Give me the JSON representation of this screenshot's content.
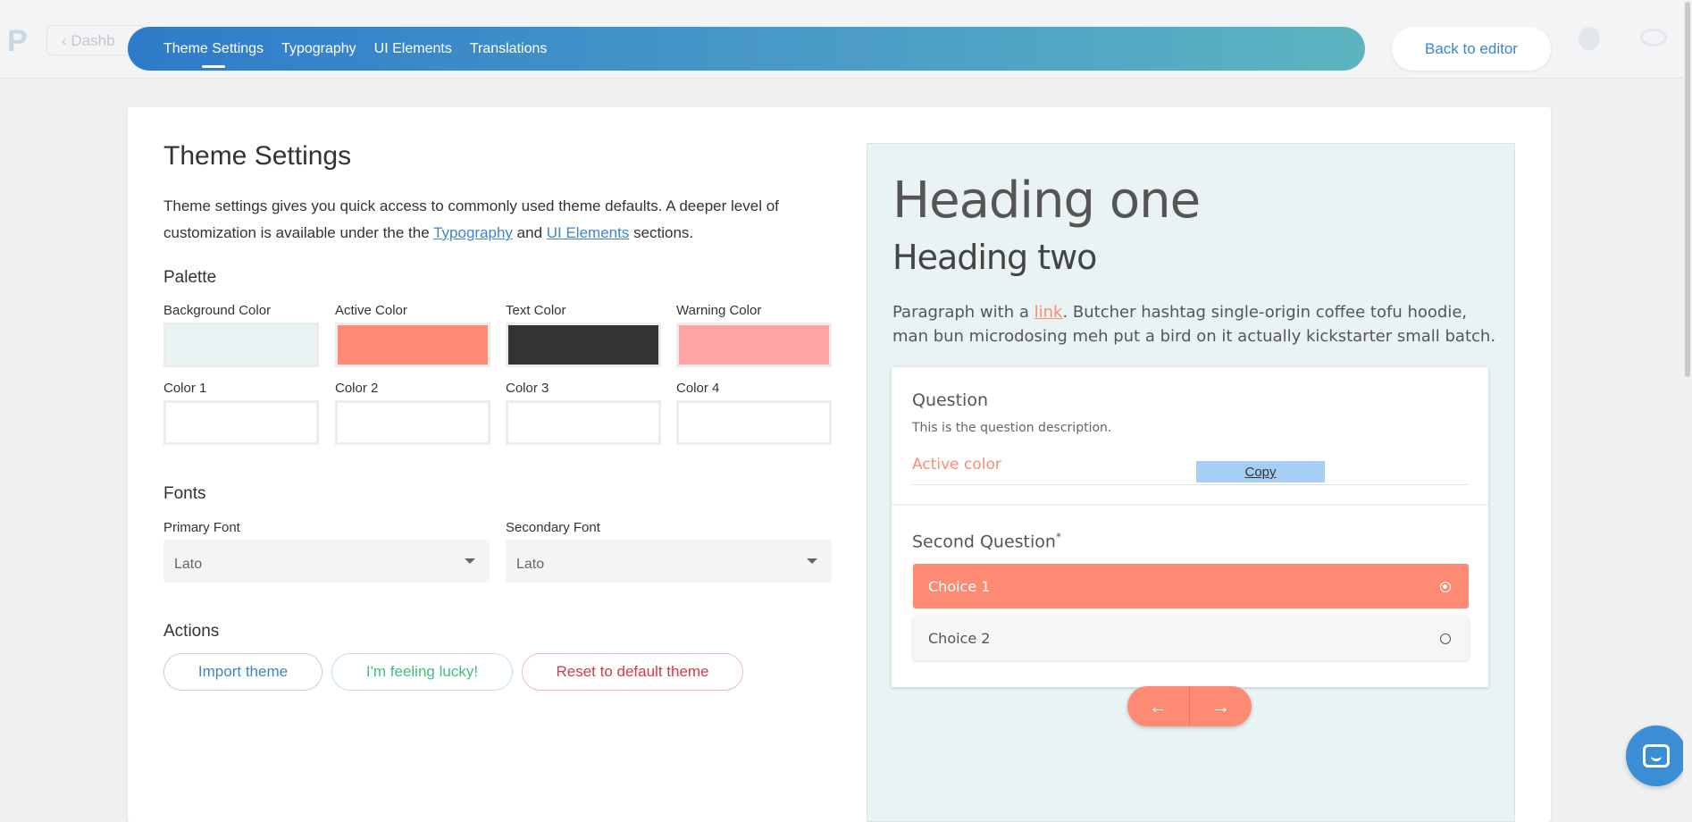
{
  "background_app": {
    "dashboard_label": "Dashb"
  },
  "topnav": {
    "tabs": [
      {
        "label": "Theme Settings",
        "active": true
      },
      {
        "label": "Typography",
        "active": false
      },
      {
        "label": "UI Elements",
        "active": false
      },
      {
        "label": "Translations",
        "active": false
      }
    ],
    "back_label": "Back to editor"
  },
  "settings": {
    "title": "Theme Settings",
    "intro_before": "Theme settings gives you quick access to commonly used theme defaults. A deeper level of customization is available under the the ",
    "intro_link1": "Typography",
    "intro_and": " and ",
    "intro_link2": "UI Elements",
    "intro_after": " sections.",
    "palette": {
      "title": "Palette",
      "colors": [
        {
          "label": "Background Color",
          "value": "#e9f3f4"
        },
        {
          "label": "Active Color",
          "value": "#ff8a73"
        },
        {
          "label": "Text Color",
          "value": "#333333"
        },
        {
          "label": "Warning Color",
          "value": "#ffa3a3"
        },
        {
          "label": "Color 1",
          "value": "#ffffff"
        },
        {
          "label": "Color 2",
          "value": "#ffffff"
        },
        {
          "label": "Color 3",
          "value": "#ffffff"
        },
        {
          "label": "Color 4",
          "value": "#ffffff"
        }
      ]
    },
    "fonts": {
      "title": "Fonts",
      "primary_label": "Primary Font",
      "primary_value": "Lato",
      "secondary_label": "Secondary Font",
      "secondary_value": "Lato"
    },
    "actions": {
      "title": "Actions",
      "import": "Import theme",
      "lucky": "I'm feeling lucky!",
      "reset": "Reset to default theme"
    }
  },
  "preview": {
    "heading_one": "Heading one",
    "heading_two": "Heading two",
    "para_before": "Paragraph with a ",
    "para_link": "link",
    "para_after": ". Butcher hashtag single-origin coffee tofu hoodie, man bun microdosing meh put a bird on it actually kickstarter small batch.",
    "question_title": "Question",
    "question_desc": "This is the question description.",
    "input_label": "Active color",
    "copy_label": "Copy",
    "second_question": "Second Question",
    "required_mark": "*",
    "choices": [
      "Choice 1",
      "Choice 2"
    ],
    "prev_arrow": "←",
    "next_arrow": "→"
  }
}
